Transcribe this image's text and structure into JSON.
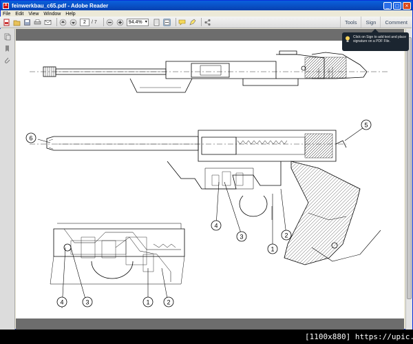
{
  "window": {
    "title": "feinwerkbau_c65.pdf - Adobe Reader",
    "controls": {
      "minimize": "_",
      "maximize": "□",
      "close": "×"
    }
  },
  "menu": [
    "File",
    "Edit",
    "View",
    "Window",
    "Help"
  ],
  "toolbar": {
    "current_page": "2",
    "total_pages": "/ 7",
    "zoom": "94.4%",
    "tabs": {
      "tools": "Tools",
      "sign": "Sign",
      "comment": "Comment"
    }
  },
  "tooltip": {
    "text": "Click on Sign to add text and place signature on a PDF File."
  },
  "diagram": {
    "callouts": [
      "6",
      "5",
      "4",
      "3",
      "1",
      "2",
      "4",
      "3",
      "1",
      "2"
    ]
  },
  "watermark": "[1100x880] https://upic.me/",
  "colors": {
    "titlebar": "#0842b0",
    "page": "#ffffff",
    "doc_bg": "#6d6d6d",
    "tooltip_bg": "#1b2530"
  }
}
